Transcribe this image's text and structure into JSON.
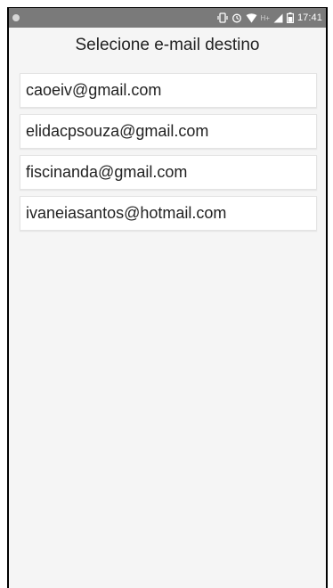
{
  "status_bar": {
    "time": "17:41",
    "icons": [
      "notification-dot-icon",
      "vibrate-icon",
      "alarm-icon",
      "wifi-icon",
      "hplus-signal-icon",
      "cell-signal-icon",
      "battery-icon"
    ],
    "network_label": "H+"
  },
  "header": {
    "title": "Selecione e-mail destino"
  },
  "email_list": {
    "items": [
      {
        "label": "caoeiv@gmail.com"
      },
      {
        "label": "elidacpsouza@gmail.com"
      },
      {
        "label": "fiscinanda@gmail.com"
      },
      {
        "label": "ivaneiasantos@hotmail.com"
      }
    ]
  },
  "colors": {
    "status_bar_bg": "#7a7a7a",
    "screen_bg": "#f5f5f5",
    "card_bg": "#ffffff",
    "text": "#222222"
  }
}
